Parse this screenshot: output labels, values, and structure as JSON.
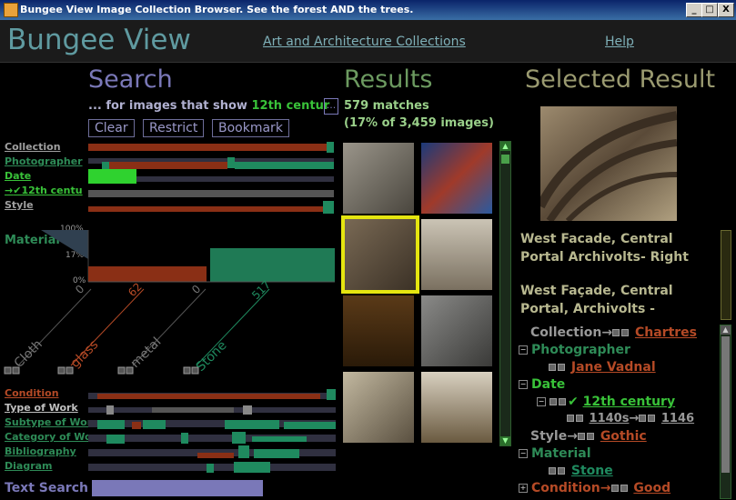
{
  "window": {
    "title": "Bungee View Image Collection Browser.  See the forest AND the trees.",
    "controls": [
      "_",
      "□",
      "X"
    ]
  },
  "header": {
    "app_title": "Bungee View",
    "collections_link": "Art and Architecture Collections",
    "help_link": "Help"
  },
  "search": {
    "heading": "Search",
    "query_prefix": "... for images that show",
    "query_value": "12th centur",
    "query_ellipsis": "...",
    "buttons": {
      "clear": "Clear",
      "restrict": "Restrict",
      "bookmark": "Bookmark"
    },
    "facets_top": [
      {
        "label": "Collection",
        "color": "#a0a0a0"
      },
      {
        "label": "Photographer",
        "color": "#2e8b57"
      },
      {
        "label": "Date",
        "color": "#39c239"
      },
      {
        "label": "Style",
        "color": "#a0a0a0"
      }
    ],
    "date_selection": "12th centu",
    "date_selection_prefix": "→",
    "material": {
      "label": "Material",
      "ticks": [
        "100%",
        "17%",
        "0%"
      ],
      "values": [
        {
          "name": "Cloth",
          "count": "0",
          "color": "#8a8a8a"
        },
        {
          "name": "glass",
          "count": "62",
          "color": "#b54a26"
        },
        {
          "name": "metal",
          "count": "0",
          "color": "#8a8a8a"
        },
        {
          "name": "Stone",
          "count": "517",
          "color": "#1f8a5f"
        }
      ]
    },
    "facets_bottom": [
      {
        "label": "Condition",
        "color": "#b54a26"
      },
      {
        "label": "Type of Work",
        "color": "#c0c0c0"
      },
      {
        "label": "Subtype of Wor",
        "color": "#2e8b57"
      },
      {
        "label": "Category of Wo",
        "color": "#2e8b57"
      },
      {
        "label": "Bibliography",
        "color": "#2e8b57"
      },
      {
        "label": "Diagram",
        "color": "#2e8b57"
      }
    ],
    "text_search_label": "Text Search",
    "text_search_value": ""
  },
  "results": {
    "heading": "Results",
    "matches": "579 matches",
    "percent": "(17% of 3,459 images)",
    "thumbnails": [
      "sculpture-1",
      "stained-glass",
      "archivolt-selected",
      "stone-fragment",
      "interior-dark",
      "stone-relief",
      "cathedral-detail",
      "spire"
    ]
  },
  "selected": {
    "heading": "Selected Result",
    "title1": "West Facade, Central Portal Archivolts- Right",
    "title2": "West Façade, Central Portal, Archivolts - Right□□At left is",
    "tree": {
      "collection_label": "Collection",
      "collection_value": "Chartres",
      "photographer_label": "Photographer",
      "photographer_value": "Jane Vadnal",
      "date_label": "Date",
      "date_value": "12th century",
      "date_range_a": "1140s",
      "date_range_b": "1146",
      "style_label": "Style",
      "style_value": "Gothic",
      "material_label": "Material",
      "material_value": "Stone",
      "condition_label": "Condition",
      "condition_value": "Good",
      "arrow": "→"
    }
  },
  "colors": {
    "search_heading": "#7a78b8",
    "results_heading": "#6c9a60",
    "selected_heading": "#9a9a70",
    "selected_frame": "#e5e510",
    "accent_green": "#39c239",
    "accent_rust": "#b54a26"
  }
}
